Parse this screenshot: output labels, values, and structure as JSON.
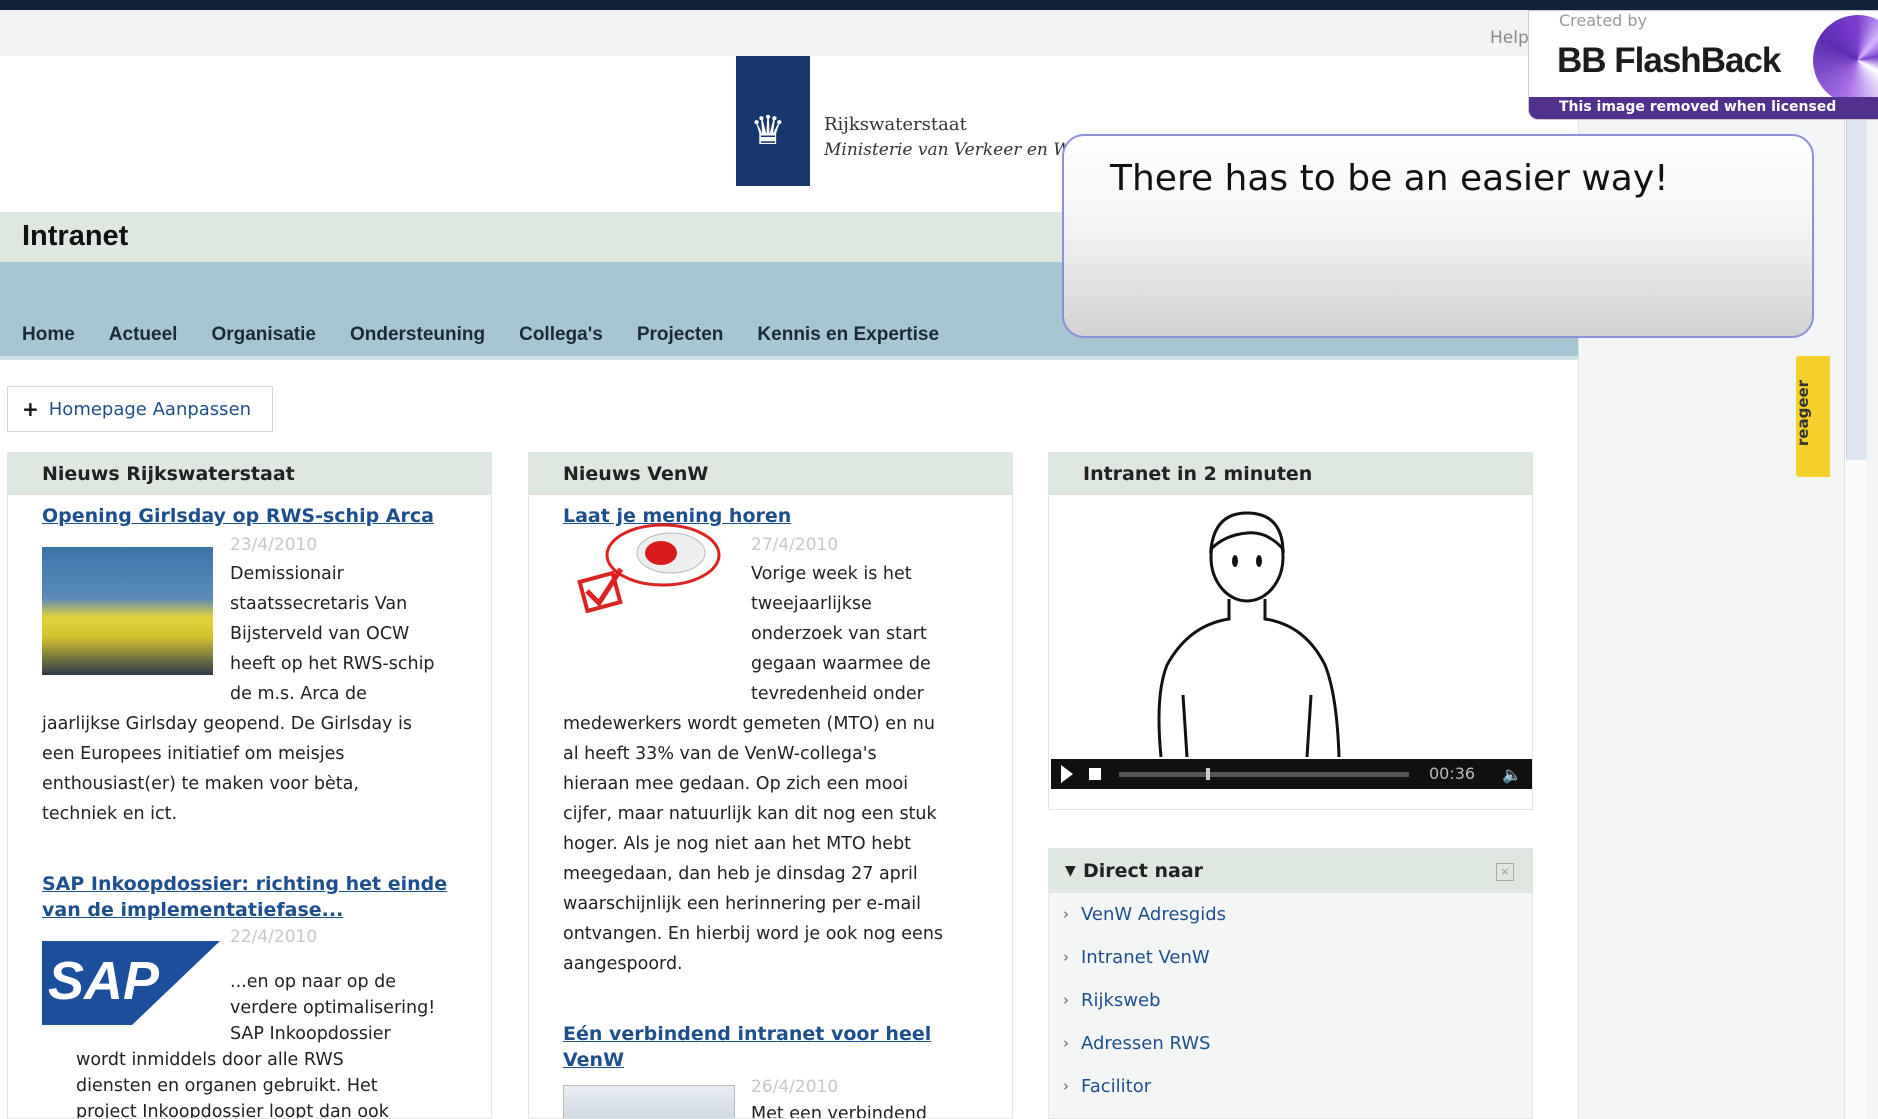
{
  "header": {
    "help": "Help",
    "org_line1": "Rijkswaterstaat",
    "org_line2": "Ministerie van Verkeer en Water",
    "site_title": "Intranet"
  },
  "nav": [
    "Home",
    "Actueel",
    "Organisatie",
    "Ondersteuning",
    "Collega's",
    "Projecten",
    "Kennis en Expertise"
  ],
  "customize_label": "Homepage Aanpassen",
  "news_rws": {
    "heading": "Nieuws Rijkswaterstaat",
    "items": [
      {
        "title": "Opening Girlsday op RWS-schip Arca",
        "date": "23/4/2010",
        "text_beside": [
          "Demissionair",
          "staatssecretaris Van",
          "Bijsterveld van OCW",
          "heeft op het RWS-schip",
          "de m.s. Arca de"
        ],
        "text_below": [
          "jaarlijkse Girlsday geopend. De Girlsday is",
          "een Europees initiatief om meisjes",
          "enthousiast(er) te maken voor bèta,",
          "techniek en ict."
        ]
      },
      {
        "title_line1": "SAP Inkoopdossier: richting het einde",
        "title_line2": "van de implementatiefase...",
        "date": "22/4/2010",
        "text_beside": [
          "...en op naar op de",
          "verdere optimalisering!",
          "SAP Inkoopdossier"
        ],
        "text_below": [
          "wordt inmiddels door alle RWS",
          "diensten en organen gebruikt. Het",
          "project Inkoopdossier loopt dan ook"
        ]
      }
    ]
  },
  "news_venw": {
    "heading": "Nieuws VenW",
    "items": [
      {
        "title": "Laat je mening horen",
        "date": "27/4/2010",
        "text_beside": [
          "Vorige week is het",
          "tweejaarlijkse",
          "onderzoek van start",
          "gegaan waarmee de",
          "tevredenheid onder"
        ],
        "text_below": [
          "medewerkers wordt gemeten (MTO) en nu",
          "al heeft 33% van de VenW-collega's",
          "hieraan mee gedaan. Op zich een mooi",
          "cijfer, maar natuurlijk kan dit nog een stuk",
          "hoger. Als je nog niet aan het MTO hebt",
          "meegedaan, dan heb je dinsdag 27 april",
          "waarschijnlijk een herinnering per e-mail",
          "ontvangen. En hierbij word je ook nog eens",
          "aangespoord."
        ]
      },
      {
        "title_line1": "Eén verbindend intranet voor heel",
        "title_line2": "VenW",
        "date": "26/4/2010",
        "text_beside": [
          "Met een verbindend"
        ]
      }
    ]
  },
  "video": {
    "heading": "Intranet in 2 minuten",
    "time": "00:36",
    "progress": 0.3
  },
  "direct": {
    "heading": "Direct naar",
    "links": [
      "VenW Adresgids",
      "Intranet VenW",
      "Rijksweb",
      "Adressen RWS",
      "Facilitor"
    ]
  },
  "callout": "There has to be an easier way!",
  "feedback_tab": "reageer",
  "watermark": {
    "created_by": "Created by",
    "brand": "BB FlashBack",
    "notice": "This image removed when licensed"
  },
  "sap_logo": "SAP"
}
